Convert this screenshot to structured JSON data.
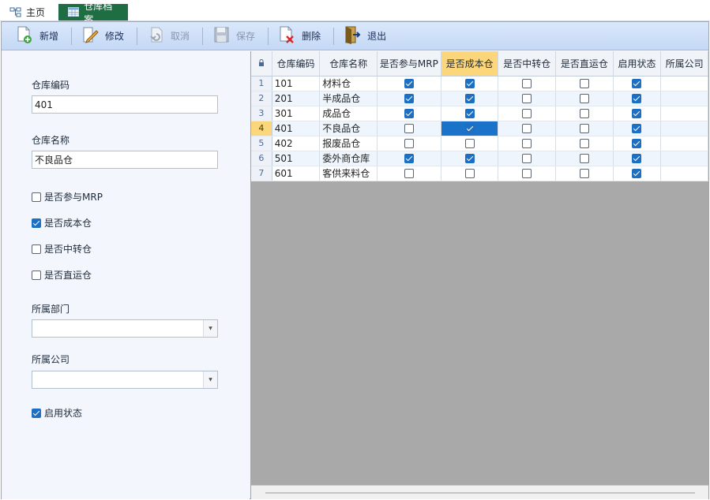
{
  "tabs": [
    {
      "label": "主页",
      "icon": "home-tree-icon"
    },
    {
      "label": "仓库档案",
      "icon": "grid-table-icon"
    }
  ],
  "toolbar": {
    "buttons": [
      {
        "label": "新增",
        "icon": "add-document-icon",
        "enabled": true
      },
      {
        "label": "修改",
        "icon": "edit-pencil-icon",
        "enabled": true
      },
      {
        "label": "取消",
        "icon": "undo-icon",
        "enabled": false
      },
      {
        "label": "保存",
        "icon": "floppy-disk-icon",
        "enabled": false
      },
      {
        "label": "删除",
        "icon": "delete-document-icon",
        "enabled": true
      },
      {
        "label": "退出",
        "icon": "exit-door-icon",
        "enabled": true
      }
    ]
  },
  "form": {
    "code_label": "仓库编码",
    "code_value": "401",
    "name_label": "仓库名称",
    "name_value": "不良品仓",
    "mrp_label": "是否参与MRP",
    "mrp_checked": false,
    "cost_label": "是否成本仓",
    "cost_checked": true,
    "transit_label": "是否中转仓",
    "transit_checked": false,
    "direct_label": "是否直运仓",
    "direct_checked": false,
    "dept_label": "所属部门",
    "dept_value": "",
    "company_label": "所属公司",
    "company_value": "",
    "enabled_label": "启用状态",
    "enabled_checked": true
  },
  "grid": {
    "columns": [
      "仓库编码",
      "仓库名称",
      "是否参与MRP",
      "是否成本仓",
      "是否中转仓",
      "是否直运仓",
      "启用状态",
      "所属公司"
    ],
    "selected_column": 3,
    "current_row": 3,
    "rows": [
      {
        "no": "1",
        "code": "101",
        "name": "材料仓",
        "mrp": true,
        "cost": true,
        "transit": false,
        "direct": false,
        "enabled": true,
        "company": ""
      },
      {
        "no": "2",
        "code": "201",
        "name": "半成品仓",
        "mrp": true,
        "cost": true,
        "transit": false,
        "direct": false,
        "enabled": true,
        "company": ""
      },
      {
        "no": "3",
        "code": "301",
        "name": "成品仓",
        "mrp": true,
        "cost": true,
        "transit": false,
        "direct": false,
        "enabled": true,
        "company": ""
      },
      {
        "no": "4",
        "code": "401",
        "name": "不良品仓",
        "mrp": false,
        "cost": true,
        "transit": false,
        "direct": false,
        "enabled": true,
        "company": ""
      },
      {
        "no": "5",
        "code": "402",
        "name": "报废品仓",
        "mrp": false,
        "cost": false,
        "transit": false,
        "direct": false,
        "enabled": true,
        "company": ""
      },
      {
        "no": "6",
        "code": "501",
        "name": "委外商仓库",
        "mrp": true,
        "cost": true,
        "transit": false,
        "direct": false,
        "enabled": true,
        "company": ""
      },
      {
        "no": "7",
        "code": "601",
        "name": "客供来料仓",
        "mrp": false,
        "cost": false,
        "transit": false,
        "direct": false,
        "enabled": true,
        "company": ""
      }
    ]
  }
}
